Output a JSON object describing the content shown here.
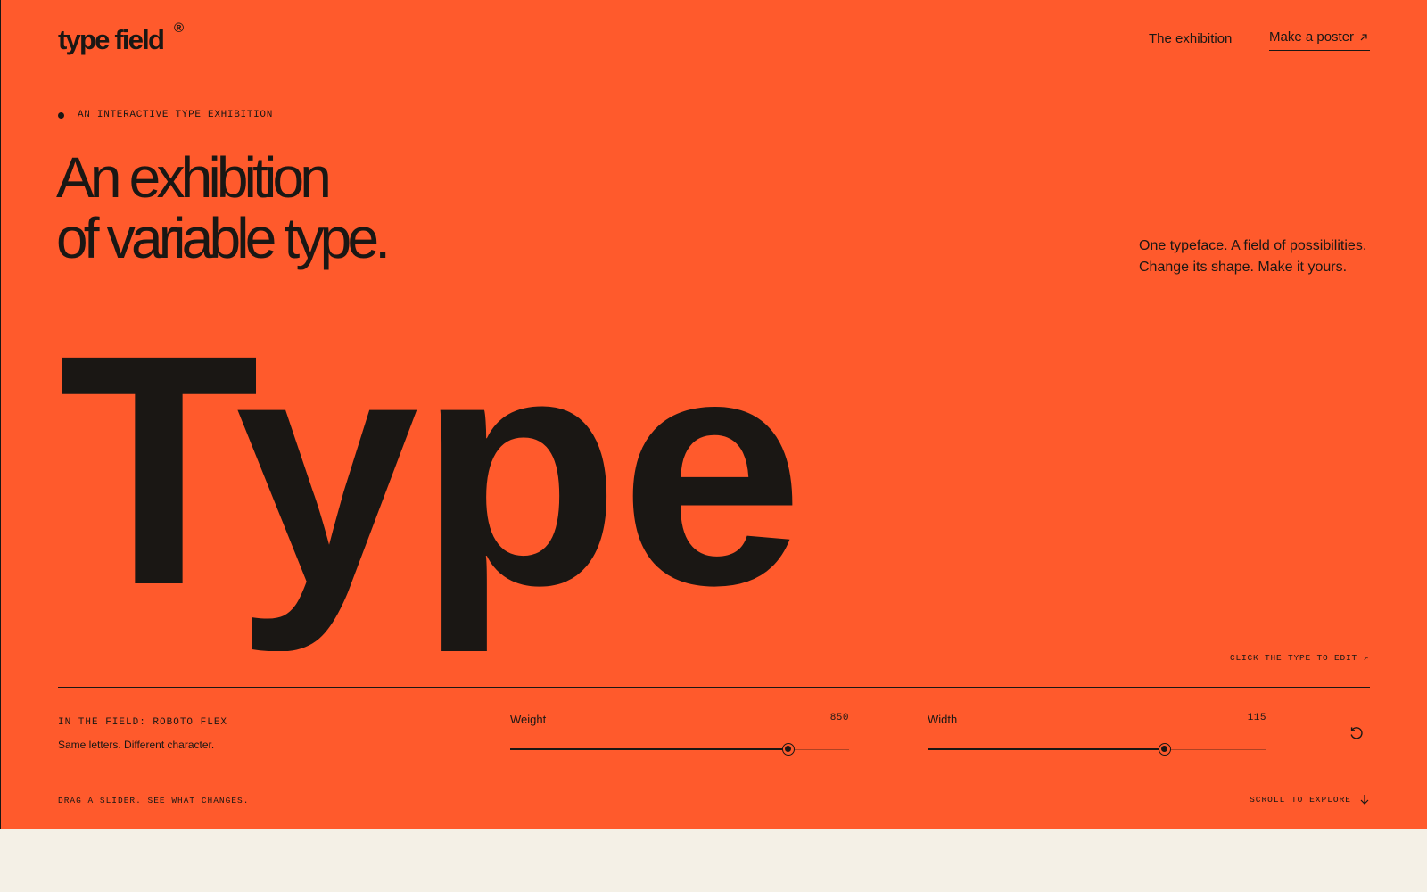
{
  "colors": {
    "accent": "#FF5A2C",
    "ink": "#1A1714",
    "paper": "#F4F0E6"
  },
  "header": {
    "logo": "type field",
    "logo_mark": "®",
    "nav_link": "The exhibition",
    "cta_label": "Make a poster",
    "cta_icon": "arrow-up-right-icon"
  },
  "hero": {
    "eyebrow": "AN INTERACTIVE TYPE EXHIBITION",
    "headline_line1": "An exhibition",
    "headline_line2": "of variable type.",
    "tagline_line1": "One typeface. A field of possibilities.",
    "tagline_line2": "Change its shape. Make it yours.",
    "specimen_word": "Type",
    "click_hint": "CLICK THE TYPE TO EDIT ↗"
  },
  "controls": {
    "field_label": "IN THE FIELD: ROBOTO FLEX",
    "field_sub": "Same letters. Different character.",
    "weight": {
      "label": "Weight",
      "value": "850",
      "fraction": 0.82
    },
    "width": {
      "label": "Width",
      "value": "115",
      "fraction": 0.7
    },
    "reset_icon": "reset-icon"
  },
  "footer": {
    "drag_hint": "DRAG A SLIDER. SEE WHAT CHANGES.",
    "scroll_hint": "SCROLL TO EXPLORE",
    "scroll_icon": "arrow-down-icon"
  }
}
